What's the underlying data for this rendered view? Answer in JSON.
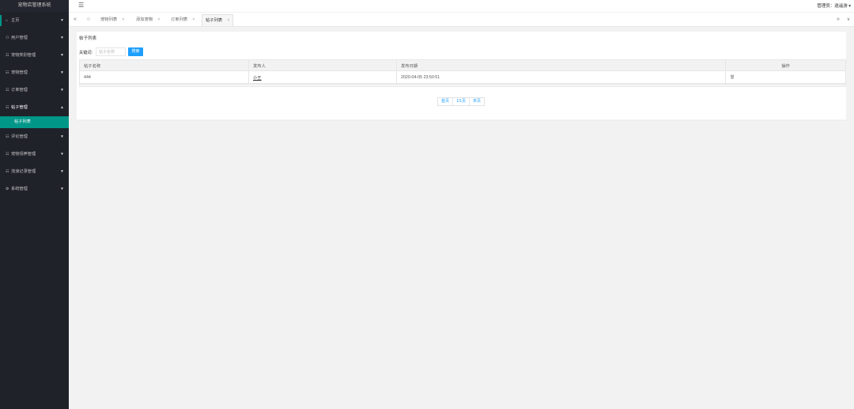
{
  "app": {
    "title": "宠物店管理系统"
  },
  "sidebar": {
    "items": [
      {
        "label": "主页",
        "icon": "home-icon",
        "glyph": "⌂"
      },
      {
        "label": "用户管理",
        "icon": "users-icon",
        "glyph": "⚇"
      },
      {
        "label": "宠物类别管理",
        "icon": "list-icon",
        "glyph": "☷"
      },
      {
        "label": "宠物管理",
        "icon": "list-icon",
        "glyph": "☷"
      },
      {
        "label": "订单管理",
        "icon": "list-icon",
        "glyph": "☷"
      },
      {
        "label": "帖子管理",
        "icon": "list-icon",
        "glyph": "☷"
      },
      {
        "label": "评论管理",
        "icon": "list-icon",
        "glyph": "☷"
      },
      {
        "label": "宠物领养管理",
        "icon": "list-icon",
        "glyph": "☷"
      },
      {
        "label": "流浪记录管理",
        "icon": "list-icon",
        "glyph": "☷"
      },
      {
        "label": "系统管理",
        "icon": "gear-icon",
        "glyph": "⚙"
      }
    ],
    "sub_item": "帖子列表"
  },
  "header": {
    "user": "管理员：逍遥游 ▾"
  },
  "tabs": [
    {
      "label": "宠物列表"
    },
    {
      "label": "添加宠物"
    },
    {
      "label": "订单列表"
    },
    {
      "label": "帖子列表"
    }
  ],
  "page": {
    "title": "帖子列表",
    "search_label": "关键词:",
    "search_placeholder": "帖子名称",
    "search_button": "搜索"
  },
  "table": {
    "headers": [
      "帖子名称",
      "发布人",
      "发布日期",
      "操作"
    ],
    "rows": [
      {
        "name": "444",
        "author": "小王",
        "date": "2020-04-05 23:50:51",
        "op": "🗑"
      }
    ]
  },
  "pager": {
    "first": "首页",
    "page": "1/1页",
    "last": "末页"
  },
  "colors": {
    "sidebar_bg": "#20222a",
    "active": "#009688",
    "button": "#1e9fff"
  }
}
